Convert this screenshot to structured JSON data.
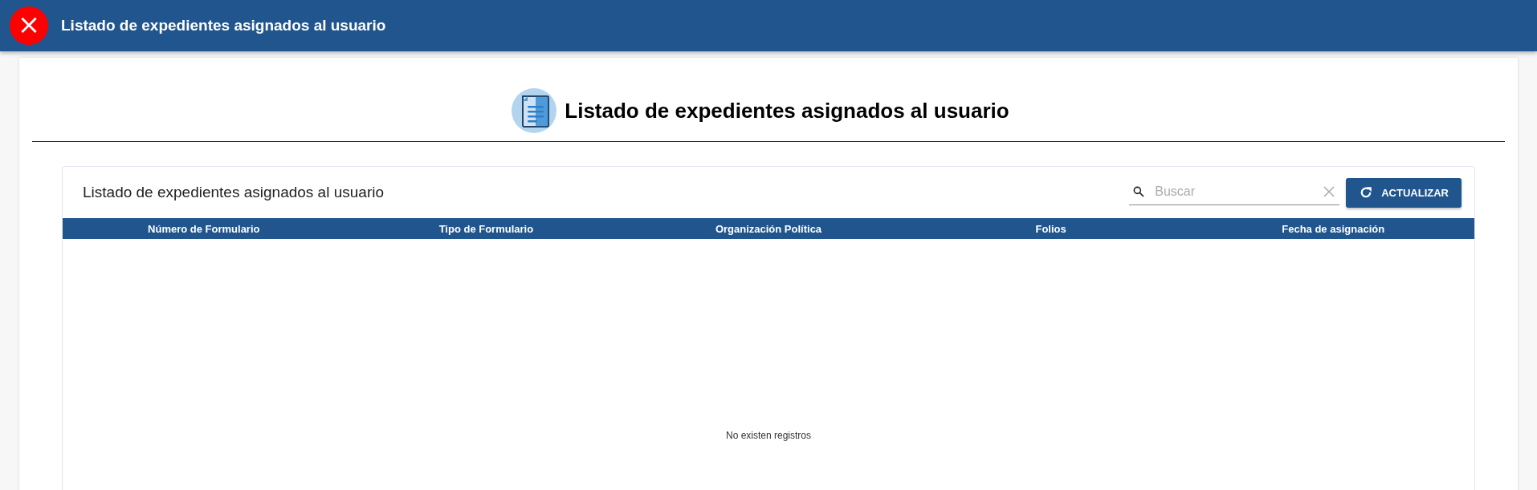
{
  "app_bar": {
    "title": "Listado de expedientes asignados al usuario",
    "close_button": {
      "label": "×"
    }
  },
  "page_heading": {
    "title": "Listado de expedientes asignados al usuario"
  },
  "card": {
    "title": "Listado de expedientes asignados al usuario",
    "search": {
      "placeholder": "Buscar"
    },
    "refresh_button": {
      "label": "ACTUALIZAR"
    },
    "table": {
      "columns": [
        "Número de Formulario",
        "Tipo de Formulario",
        "Organización Política",
        "Folios",
        "Fecha de asignación"
      ],
      "empty_message": "No existen registros"
    }
  }
}
